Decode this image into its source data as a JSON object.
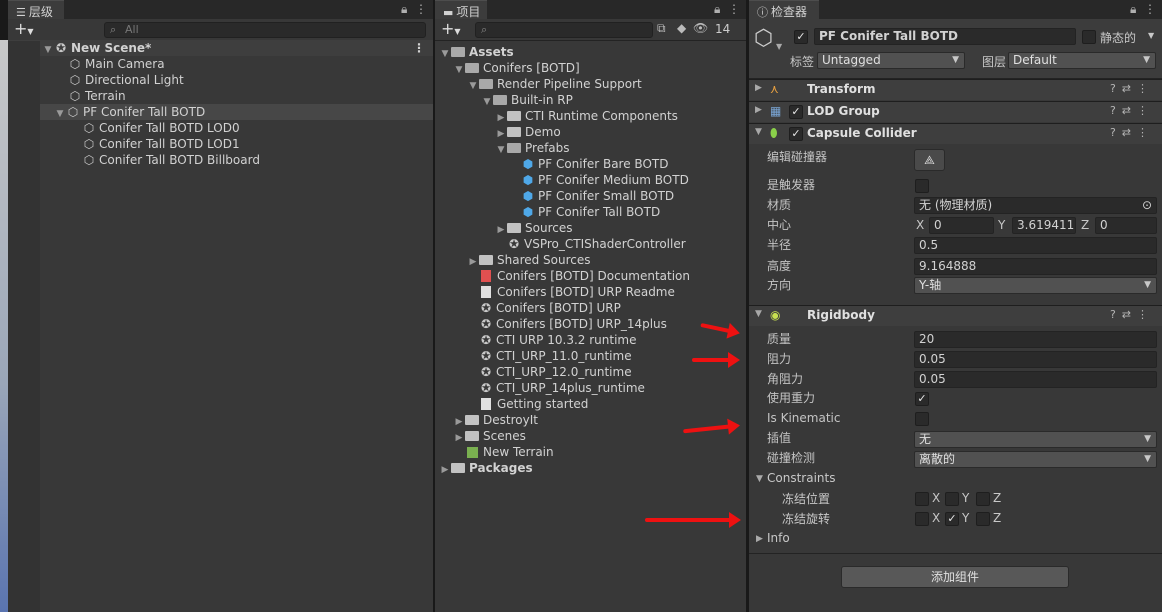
{
  "hierarchy": {
    "tab": "层级",
    "search_placeholder": "All",
    "add": "+",
    "scene": "New Scene*",
    "items": [
      "Main Camera",
      "Directional Light",
      "Terrain",
      "PF Conifer Tall BOTD"
    ],
    "children": [
      "Conifer Tall BOTD LOD0",
      "Conifer Tall BOTD LOD1",
      "Conifer Tall BOTD Billboard"
    ]
  },
  "project": {
    "tab": "项目",
    "hidden_count": "14",
    "add": "+",
    "tree": [
      "Assets",
      "Conifers [BOTD]",
      "Render Pipeline Support",
      "Built-in RP",
      "CTI Runtime Components",
      "Demo",
      "Prefabs",
      "PF Conifer Bare BOTD",
      "PF Conifer Medium BOTD",
      "PF Conifer Small BOTD",
      "PF Conifer Tall BOTD",
      "Sources",
      "VSPro_CTIShaderController",
      "Shared Sources",
      "Conifers [BOTD] Documentation",
      "Conifers [BOTD] URP Readme",
      "Conifers [BOTD] URP",
      "Conifers [BOTD] URP_14plus",
      "CTI URP 10.3.2 runtime",
      "CTI_URP_11.0_runtime",
      "CTI_URP_12.0_runtime",
      "CTI_URP_14plus_runtime",
      "Getting started",
      "DestroyIt",
      "Scenes",
      "New Terrain",
      "Packages"
    ]
  },
  "inspector": {
    "tab": "检查器",
    "object_name": "PF Conifer Tall BOTD",
    "static_label": "静态的",
    "tag_label": "标签",
    "tag_value": "Untagged",
    "layer_label": "图层",
    "layer_value": "Default",
    "components": {
      "transform": "Transform",
      "lod": "LOD Group",
      "capsule": "Capsule Collider",
      "rigidbody": "Rigidbody"
    },
    "capsule": {
      "edit_label": "编辑碰撞器",
      "trigger_label": "是触发器",
      "material_label": "材质",
      "material_value": "无 (物理材质)",
      "center_label": "中心",
      "x": "X",
      "y": "Y",
      "z": "Z",
      "cx": "0",
      "cy": "3.619411",
      "cz": "0",
      "radius_label": "半径",
      "radius": "0.5",
      "height_label": "高度",
      "height": "9.164888",
      "direction_label": "方向",
      "direction": "Y-轴"
    },
    "rigidbody": {
      "mass_label": "质量",
      "mass": "20",
      "drag_label": "阻力",
      "drag": "0.05",
      "angular_label": "角阻力",
      "angular": "0.05",
      "gravity_label": "使用重力",
      "kinematic_label": "Is Kinematic",
      "interp_label": "插值",
      "interp": "无",
      "collision_label": "碰撞检测",
      "collision": "离散的",
      "constraints_label": "Constraints",
      "freeze_pos_label": "冻结位置",
      "freeze_rot_label": "冻结旋转",
      "info_label": "Info"
    },
    "add_component": "添加组件"
  }
}
